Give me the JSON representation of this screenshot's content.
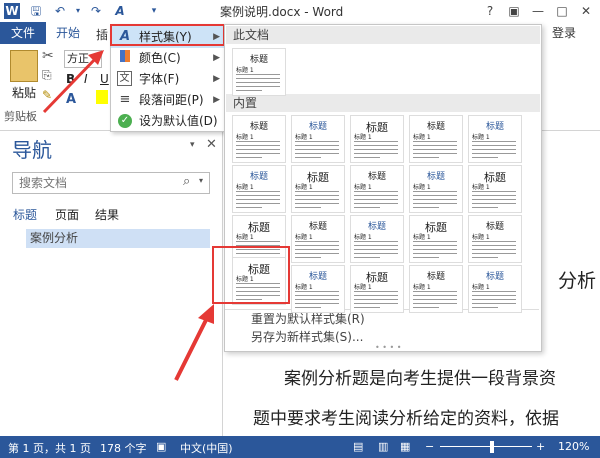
{
  "title_bar": {
    "title": "案例说明.docx - Word",
    "help": "?",
    "ribbon_display": "▣",
    "minimize": "—",
    "maximize": "□",
    "close": "✕"
  },
  "ribbon": {
    "tab_file": "文件",
    "tab_home": "开始",
    "tab_design_partial": "插",
    "login": "登录",
    "paste_label": "粘贴",
    "clipboard_label": "剪贴板",
    "font_partial": "方正"
  },
  "style_menu": {
    "items": [
      {
        "label": "样式集(Y)",
        "icon": "style-set-icon",
        "has_arrow": true
      },
      {
        "label": "颜色(C)",
        "icon": "colors-icon",
        "has_arrow": true
      },
      {
        "label": "字体(F)",
        "icon": "fonts-icon",
        "has_arrow": true
      },
      {
        "label": "段落间距(P)",
        "icon": "paragraph-spacing-icon",
        "has_arrow": true
      },
      {
        "label": "设为默认值(D)",
        "icon": "check-circle-icon",
        "has_arrow": false
      }
    ]
  },
  "gallery": {
    "section_this_doc": "此文档",
    "section_builtin": "内置",
    "thumb_title": "标题",
    "thumb_subtitle": "标题 1",
    "footer_reset": "重置为默认样式集(R)",
    "footer_save": "另存为新样式集(S)..."
  },
  "navigation": {
    "title": "导航",
    "search_placeholder": "搜索文档",
    "tabs": [
      "标题",
      "页面",
      "结果"
    ],
    "items": [
      "案例分析"
    ]
  },
  "document": {
    "heading_partial": "分析",
    "line1": "案例分析题是向考生提供一段背景资",
    "line2": "题中要求考生阅读分析给定的资料，依据"
  },
  "status_bar": {
    "page": "第 1 页，共 1 页",
    "words": "178 个字",
    "language": "中文(中国)",
    "zoom": "120%"
  },
  "colors": {
    "accent": "#2b579a",
    "highlight": "#e53935",
    "menu_hover": "#cde3f7"
  }
}
